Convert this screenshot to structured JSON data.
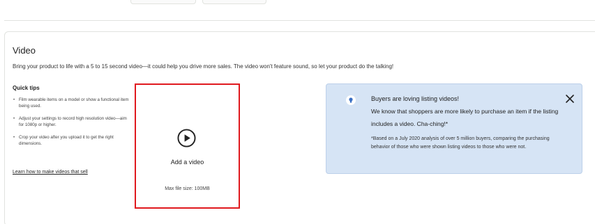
{
  "section": {
    "title": "Video",
    "subtitle": "Bring your product to life with a 5 to 15 second video—it could help you drive more sales. The video won't feature sound, so let your product do the talking!"
  },
  "quick_tips": {
    "title": "Quick tips",
    "items": [
      "Film wearable items on a model or show a functional item being used.",
      "Adjust your settings to record high resolution video—aim for 1080p or higher.",
      "Crop your video after you upload it to get the right dimensions."
    ],
    "link": "Learn how to make videos that sell"
  },
  "upload": {
    "label": "Add a video",
    "max_size": "Max file size: 100MB",
    "icon": "play-circle-icon",
    "highlight_color": "#e0191e"
  },
  "banner": {
    "title": "Buyers are loving listing videos!",
    "body": "We know that shoppers are more likely to purchase an item if the listing includes a video. Cha-ching!*",
    "footnote": "*Based on a July 2020 analysis of over 5 million buyers, comparing the purchasing behavior of those who were shown listing videos to those who were not.",
    "background": "#d6e4f5",
    "icon": "lightbulb-icon",
    "close_icon": "close-icon"
  }
}
